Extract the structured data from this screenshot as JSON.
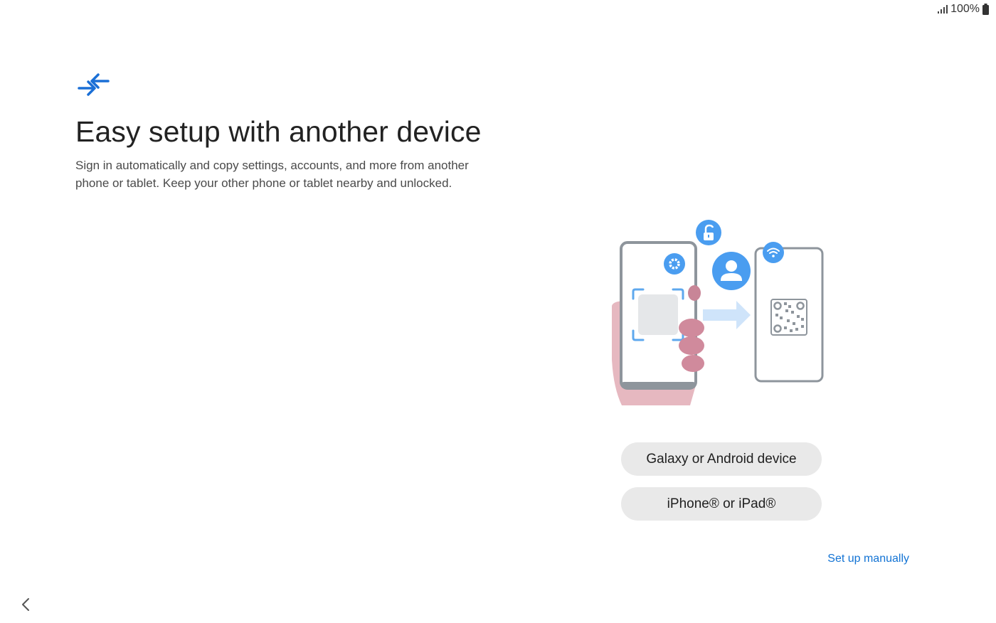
{
  "status_bar": {
    "signal_icon": "signal-bars-icon",
    "battery_text": "100%",
    "battery_icon": "battery-full-icon"
  },
  "header": {
    "icon": "arrows-converge-icon",
    "icon_color": "#1a6fd6",
    "title": "Easy setup with another device",
    "subtitle": "Sign in automatically and copy settings, accounts, and more from another phone or tablet. Keep your other phone or tablet nearby and unlocked."
  },
  "illustration": {
    "icons": [
      "lock-open-icon",
      "gear-icon",
      "person-icon",
      "wifi-icon",
      "qr-code-icon",
      "transfer-arrow-icon"
    ],
    "accent_color": "#4a9df0"
  },
  "options": {
    "galaxy_label": "Galaxy or Android device",
    "iphone_label": "iPhone® or iPad®"
  },
  "footer": {
    "manual_link": "Set up manually",
    "link_color": "#1273d4",
    "back_icon": "chevron-left-icon"
  }
}
